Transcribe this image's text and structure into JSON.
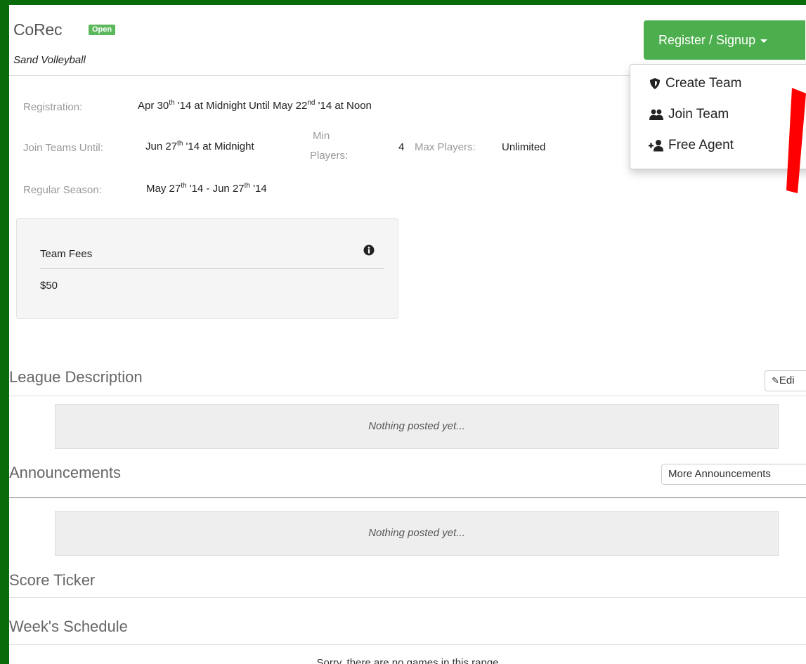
{
  "header": {
    "title": "CoRec",
    "badge": "Open",
    "subtitle": "Sand Volleyball"
  },
  "register": {
    "button_label": "Register / Signup",
    "menu": [
      {
        "label": "Create Team",
        "icon": "shield-icon"
      },
      {
        "label": "Join Team",
        "icon": "users-icon"
      },
      {
        "label": "Free Agent",
        "icon": "user-plus-icon"
      }
    ]
  },
  "info": {
    "registration_label": "Registration:",
    "registration_value": {
      "p1": "Apr 30",
      "s1": "th",
      "p2": " '14 at Midnight Until May 22",
      "s2": "nd",
      "p3": " '14 at Noon"
    },
    "join_label": "Join Teams Until:",
    "join_value": {
      "p1": "Jun 27",
      "s1": "th",
      "p2": " '14 at Midnight"
    },
    "min_label_1": "Min",
    "min_label_2": "Players:",
    "min_value": "4",
    "max_label": "Max Players:",
    "max_value": "Unlimited",
    "season_label": "Regular Season:",
    "season_value": {
      "p1": "May 27",
      "s1": "th",
      "p2": " '14 - Jun 27",
      "s2": "th",
      "p3": " '14"
    }
  },
  "fees": {
    "title": "Team Fees",
    "amount": "$50",
    "info_icon": "info-icon"
  },
  "sections": {
    "description_title": "League Description",
    "edit_label": "Edi",
    "description_empty": "Nothing posted yet...",
    "announcements_title": "Announcements",
    "more_label": "More Announcements",
    "announcements_empty": "Nothing posted yet...",
    "score_title": "Score Ticker",
    "schedule_title": "Week's Schedule",
    "schedule_empty": "Sorry, there are no games in this range"
  },
  "colors": {
    "frame": "#0a6b0a",
    "success": "#4cae4c",
    "arrow": "#ff0000"
  }
}
